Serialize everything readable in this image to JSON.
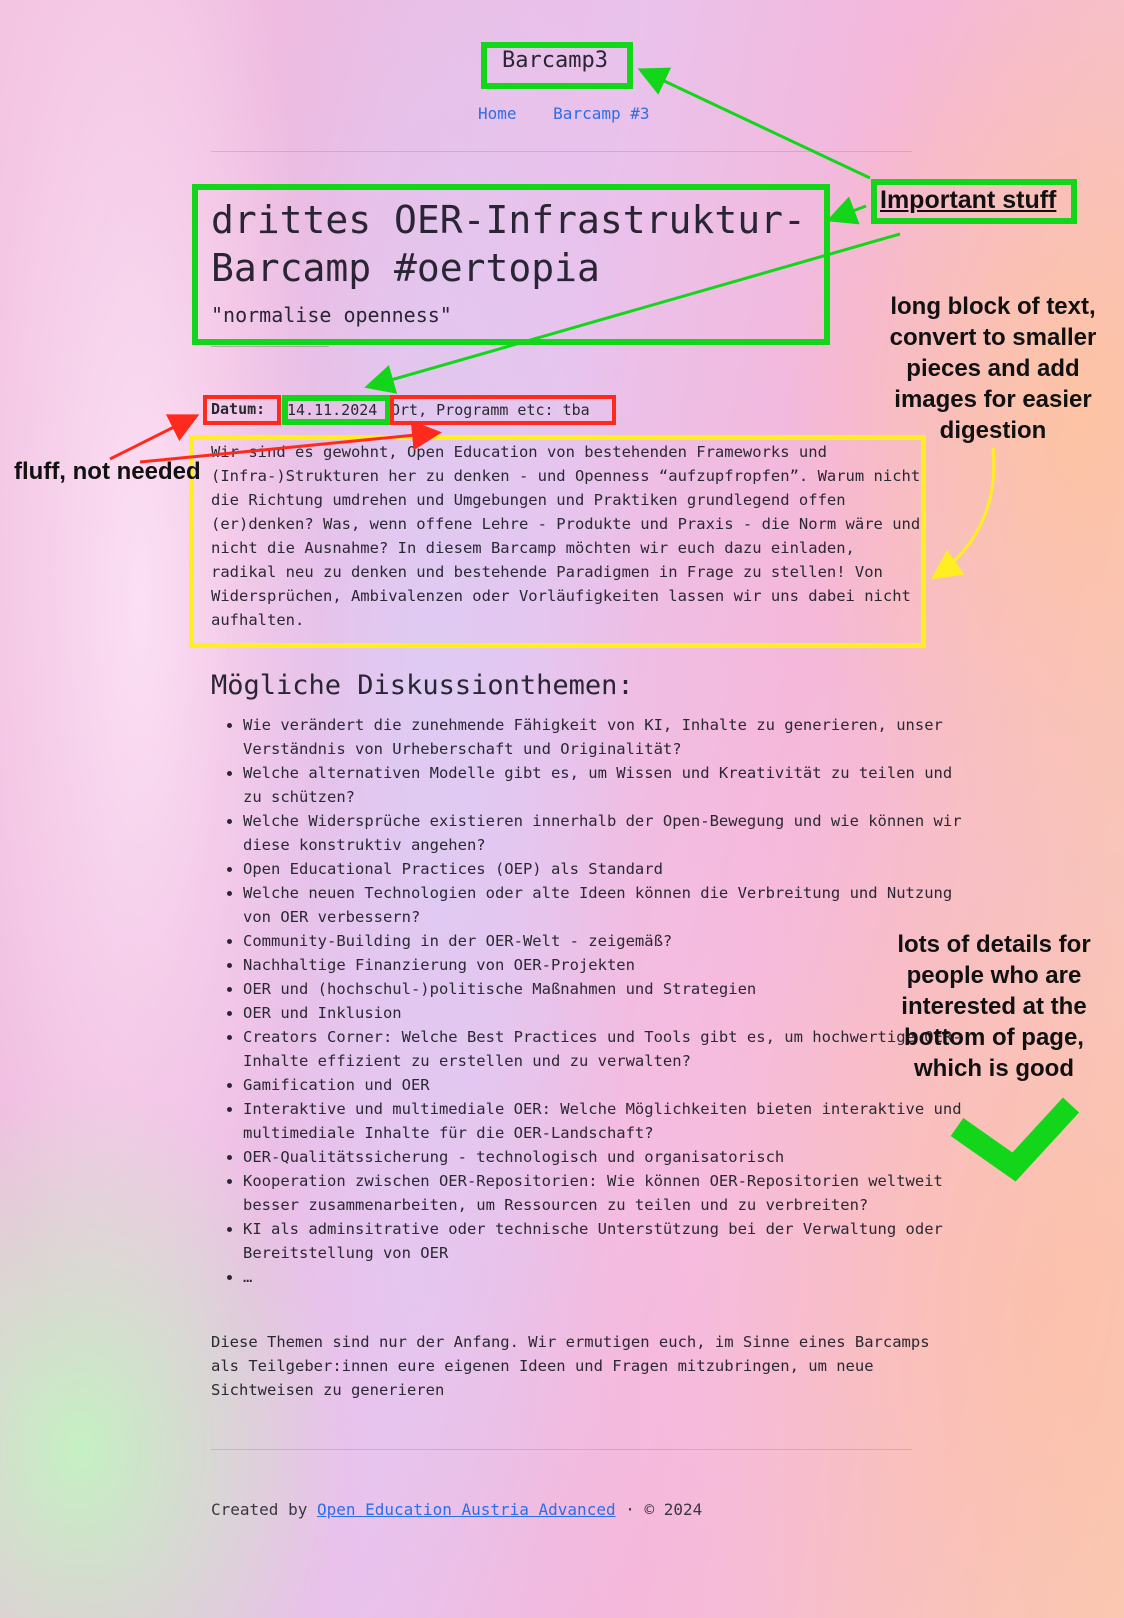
{
  "header": {
    "site_title": "Barcamp3",
    "nav": [
      "Home",
      "Barcamp #3"
    ]
  },
  "hero": {
    "title": "drittes OER-Infrastruktur-Barcamp #oertopia",
    "tagline": "\"normalise openness\""
  },
  "meta": {
    "date_label": "Datum:",
    "date_value": "14.11.2024",
    "location_text": "Ort, Programm etc: tba"
  },
  "intro": "Wir sind es gewohnt, Open Education von bestehenden Frameworks und (Infra-)Strukturen her zu denken - und Openness “aufzupfropfen”. Warum nicht die Richtung umdrehen und Umgebungen und Praktiken grundlegend offen (er)denken? Was, wenn offene Lehre - Produkte und Praxis - die Norm wäre und nicht die Ausnahme? In diesem Barcamp möchten wir euch dazu einladen, radikal neu zu denken und bestehende Paradigmen in Frage zu stellen! Von Widersprüchen, Ambivalenzen oder Vorläufigkeiten lassen wir uns dabei nicht aufhalten.",
  "topics": {
    "heading": "Mögliche Diskussionthemen:",
    "items": [
      "Wie verändert die zunehmende Fähigkeit von KI, Inhalte zu generieren, unser Verständnis von Urheberschaft und Originalität?",
      "Welche alternativen Modelle gibt es, um Wissen und Kreativität zu teilen und zu schützen?",
      "Welche Widersprüche existieren innerhalb der Open-Bewegung und wie können wir diese konstruktiv angehen?",
      "Open Educational Practices (OEP) als Standard",
      "Welche neuen Technologien oder alte Ideen können die Verbreitung und Nutzung von OER verbessern?",
      "Community-Building in der OER-Welt - zeigemäß?",
      "Nachhaltige Finanzierung von OER-Projekten",
      "OER und (hochschul-)politische Maßnahmen und Strategien",
      "OER und Inklusion",
      "Creators Corner: Welche Best Practices und Tools gibt es, um hochwertige OER-Inhalte effizient zu erstellen und zu verwalten?",
      "Gamification und OER",
      "Interaktive und multimediale OER: Welche Möglichkeiten bieten interaktive und multimediale Inhalte für die OER-Landschaft?",
      "OER-Qualitätssicherung - technologisch und organisatorisch",
      "Kooperation zwischen OER-Repositorien: Wie können OER-Repositorien weltweit besser zusammenarbeiten, um Ressourcen zu teilen und zu verbreiten?",
      "KI als adminsitrative oder technische Unterstützung bei der Verwaltung oder Bereitstellung von OER",
      "…"
    ],
    "outro": "Diese Themen sind nur der Anfang. Wir ermutigen euch, im Sinne eines Barcamps als Teilgeber:innen eure eigenen Ideen und Fragen mitzubringen, um neue Sichtweisen zu generieren"
  },
  "footer": {
    "prefix": "Created by",
    "link": "Open Education Austria Advanced",
    "suffix": "· © 2024"
  },
  "annotations": {
    "important": "Important stuff",
    "fluff": "fluff, not needed",
    "long_text": "long block of text, convert to smaller pieces and add images for easier digestion",
    "details": "lots of details for people who are interested at the bottom of page, which is good"
  },
  "colors": {
    "green": "#13d61a",
    "red": "#ff2a1e",
    "yellow": "#ffee22",
    "link": "#2c6ee6"
  }
}
